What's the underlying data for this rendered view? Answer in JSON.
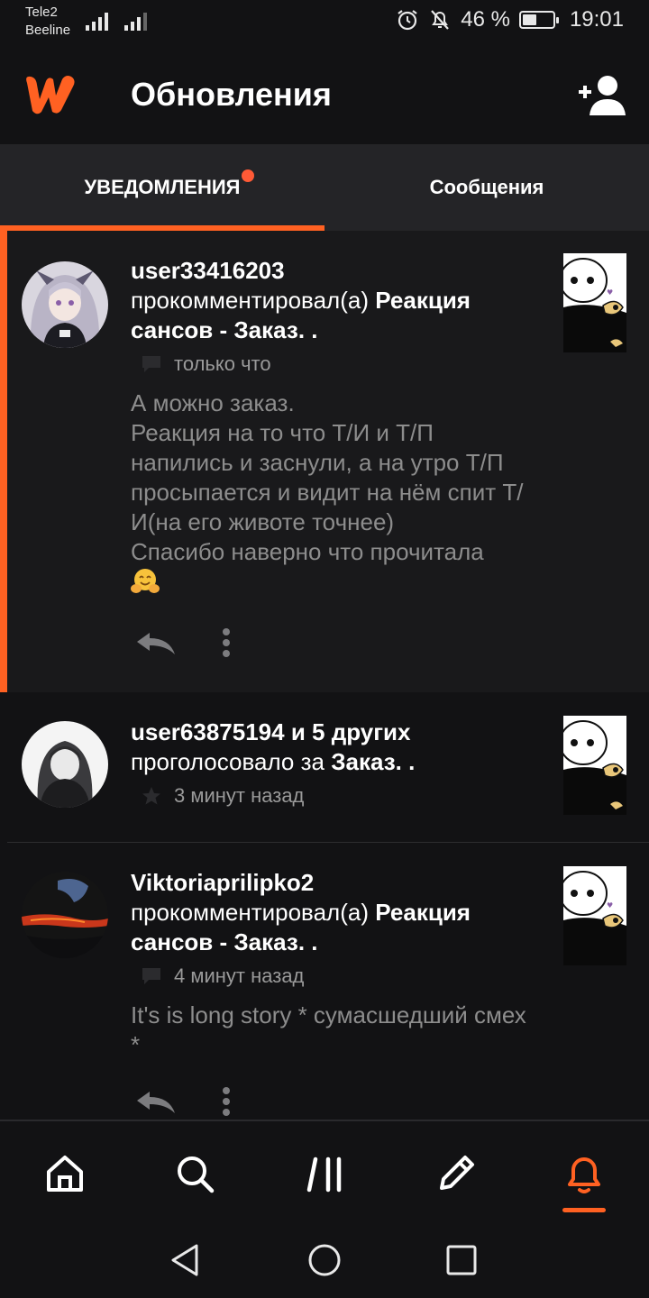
{
  "status_bar": {
    "carrier_1": "Tele2",
    "carrier_2": "Beeline",
    "battery": "46 %",
    "battery_level": 0.46,
    "time": "19:01"
  },
  "header": {
    "title": "Обновления"
  },
  "tabs": [
    {
      "label": "УВЕДОМЛЕНИЯ",
      "active": true,
      "has_dot": true
    },
    {
      "label": "Сообщения",
      "active": false
    }
  ],
  "notifications": [
    {
      "user": "user33416203",
      "action": "прокомментировал(а) ",
      "story": "Реакция сансов - Заказ.",
      "suffix": " .",
      "meta_icon": "comment-icon",
      "time": "только что",
      "comment": "А можно заказ.\nРеакция на то что Т/И и Т/П напились и заснули, а на утро Т/П просыпается и видит на нём спит Т/И(на его животе точнее)\nСпасибо наверно что прочитала",
      "has_emoji": true
    },
    {
      "user": "user63875194 и 5 других",
      "action": "проголосовало за ",
      "story": "Заказ.",
      "suffix": " .",
      "meta_icon": "star-icon",
      "time": "3 минут назад"
    },
    {
      "user": "Viktoriaprilipko2",
      "action": "прокомментировал(а) ",
      "story": "Реакция сансов - Заказ.",
      "suffix": " .",
      "meta_icon": "comment-icon",
      "time": "4 минут назад",
      "comment": "It's is long story * сумасшедший смех *"
    }
  ],
  "bottom_nav": [
    "home-icon",
    "search-icon",
    "library-icon",
    "write-icon",
    "bell-icon"
  ],
  "active_nav": "bell-icon",
  "colors": {
    "accent": "#ff6122",
    "background": "#121214",
    "tabbar": "#242427",
    "muted_text": "#8d8d8d"
  }
}
